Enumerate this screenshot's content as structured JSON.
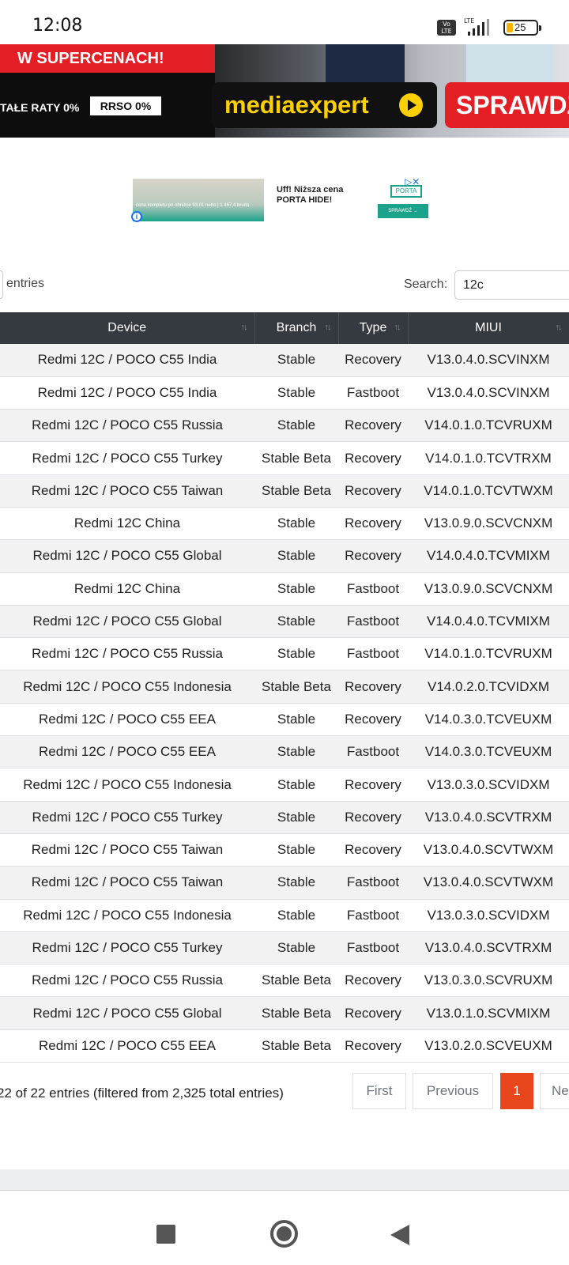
{
  "status_bar": {
    "time": "12:08",
    "volte_label": "Vo LTE",
    "network_label": "LTE",
    "battery_percent": "25"
  },
  "ad_banner": {
    "headline": "W SUPERCENACH!",
    "installments": "TAŁE RATY 0%",
    "rrso": "RRSO 0%",
    "brand": "mediaexpert",
    "cta": "SPRAWDŹ"
  },
  "ad_small": {
    "image_caption": "cena kompletu po obniżce 93,01 netto | 1 467,4 brutto",
    "text": "Uff! Niższa cena PORTA HIDE!",
    "logo": "PORTA",
    "button": "SPRAWDŹ →",
    "info_icon": "i"
  },
  "controls": {
    "entries_label": "entries",
    "search_label": "Search:",
    "search_value": "12c"
  },
  "table": {
    "columns": [
      "Device",
      "Branch",
      "Type",
      "MIUI"
    ],
    "sort_icon": "↑↓",
    "rows": [
      [
        "Redmi 12C / POCO C55 India",
        "Stable",
        "Recovery",
        "V13.0.4.0.SCVINXM"
      ],
      [
        "Redmi 12C / POCO C55 India",
        "Stable",
        "Fastboot",
        "V13.0.4.0.SCVINXM"
      ],
      [
        "Redmi 12C / POCO C55 Russia",
        "Stable",
        "Recovery",
        "V14.0.1.0.TCVRUXM"
      ],
      [
        "Redmi 12C / POCO C55 Turkey",
        "Stable Beta",
        "Recovery",
        "V14.0.1.0.TCVTRXM"
      ],
      [
        "Redmi 12C / POCO C55 Taiwan",
        "Stable Beta",
        "Recovery",
        "V14.0.1.0.TCVTWXM"
      ],
      [
        "Redmi 12C China",
        "Stable",
        "Recovery",
        "V13.0.9.0.SCVCNXM"
      ],
      [
        "Redmi 12C / POCO C55 Global",
        "Stable",
        "Recovery",
        "V14.0.4.0.TCVMIXM"
      ],
      [
        "Redmi 12C China",
        "Stable",
        "Fastboot",
        "V13.0.9.0.SCVCNXM"
      ],
      [
        "Redmi 12C / POCO C55 Global",
        "Stable",
        "Fastboot",
        "V14.0.4.0.TCVMIXM"
      ],
      [
        "Redmi 12C / POCO C55 Russia",
        "Stable",
        "Fastboot",
        "V14.0.1.0.TCVRUXM"
      ],
      [
        "Redmi 12C / POCO C55 Indonesia",
        "Stable Beta",
        "Recovery",
        "V14.0.2.0.TCVIDXM"
      ],
      [
        "Redmi 12C / POCO C55 EEA",
        "Stable",
        "Recovery",
        "V14.0.3.0.TCVEUXM"
      ],
      [
        "Redmi 12C / POCO C55 EEA",
        "Stable",
        "Fastboot",
        "V14.0.3.0.TCVEUXM"
      ],
      [
        "Redmi 12C / POCO C55 Indonesia",
        "Stable",
        "Recovery",
        "V13.0.3.0.SCVIDXM"
      ],
      [
        "Redmi 12C / POCO C55 Turkey",
        "Stable",
        "Recovery",
        "V13.0.4.0.SCVTRXM"
      ],
      [
        "Redmi 12C / POCO C55 Taiwan",
        "Stable",
        "Recovery",
        "V13.0.4.0.SCVTWXM"
      ],
      [
        "Redmi 12C / POCO C55 Taiwan",
        "Stable",
        "Fastboot",
        "V13.0.4.0.SCVTWXM"
      ],
      [
        "Redmi 12C / POCO C55 Indonesia",
        "Stable",
        "Fastboot",
        "V13.0.3.0.SCVIDXM"
      ],
      [
        "Redmi 12C / POCO C55 Turkey",
        "Stable",
        "Fastboot",
        "V13.0.4.0.SCVTRXM"
      ],
      [
        "Redmi 12C / POCO C55 Russia",
        "Stable Beta",
        "Recovery",
        "V13.0.3.0.SCVRUXM"
      ],
      [
        "Redmi 12C / POCO C55 Global",
        "Stable Beta",
        "Recovery",
        "V13.0.1.0.SCVMIXM"
      ],
      [
        "Redmi 12C / POCO C55 EEA",
        "Stable Beta",
        "Recovery",
        "V13.0.2.0.SCVEUXM"
      ]
    ]
  },
  "footer": {
    "info": "22 of 22 entries (filtered from 2,325 total entries)",
    "pagination": {
      "first": "First",
      "previous": "Previous",
      "current": "1",
      "next": "Ne"
    }
  },
  "colors": {
    "header_bg": "#343a40",
    "active_page": "#e8461c",
    "ad_red": "#e31e24",
    "brand_yellow": "#ffd000"
  },
  "icons": {
    "nav_recents": "square-icon",
    "nav_home": "circle-icon",
    "nav_back": "triangle-back-icon"
  }
}
